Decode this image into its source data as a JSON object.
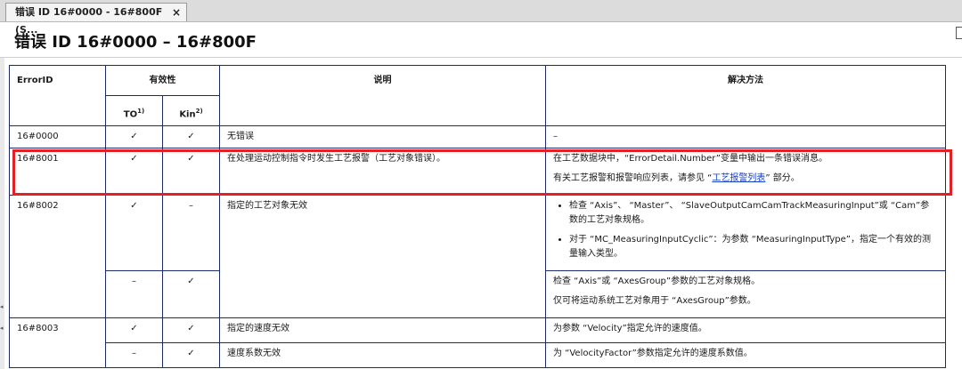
{
  "tab": {
    "label": "错误 ID 16#0000 - 16#800F (S...",
    "close_glyph": "×"
  },
  "page": {
    "title": "错误 ID 16#0000 – 16#800F"
  },
  "table": {
    "headers": {
      "error_id": "ErrorID",
      "validity": "有效性",
      "description": "说明",
      "remedy": "解决方法",
      "to": "TO",
      "to_note": "1)",
      "kin": "Kin",
      "kin_note": "2)"
    },
    "rows": [
      {
        "id": "16#0000",
        "to": "✓",
        "kin": "✓",
        "description": "无错误",
        "remedy": "–"
      },
      {
        "id": "16#8001",
        "to": "✓",
        "kin": "✓",
        "description": "在处理运动控制指令时发生工艺报警（工艺对象错误）。",
        "remedy_line1": "在工艺数据块中，“ErrorDetail.Number”变量中输出一条错误消息。",
        "remedy_line2_prefix": "有关工艺报警和报警响应列表，请参见 “",
        "remedy_link": "工艺报警列表",
        "remedy_line2_suffix": "” 部分。"
      },
      {
        "id": "16#8002",
        "description": "指定的工艺对象无效",
        "sub": [
          {
            "to": "✓",
            "kin": "–",
            "remedy_bullets": [
              "检查 “Axis”、 “Master”、 “SlaveOutputCamCamTrackMeasuringInput”或 “Cam”参数的工艺对象规格。",
              "对于 “MC_MeasuringInputCyclic”：为参数 “MeasuringInputType”，指定一个有效的测量输入类型。"
            ]
          },
          {
            "to": "–",
            "kin": "✓",
            "remedy_line1": "检查 “Axis”或 “AxesGroup”参数的工艺对象规格。",
            "remedy_line2": "仅可将运动系统工艺对象用于 “AxesGroup”参数。"
          }
        ]
      },
      {
        "id": "16#8003",
        "sub": [
          {
            "to": "✓",
            "kin": "✓",
            "description": "指定的速度无效",
            "remedy": "为参数 “Velocity”指定允许的速度值。"
          },
          {
            "to": "–",
            "kin": "✓",
            "description": "速度系数无效",
            "remedy": "为 “VelocityFactor”参数指定允许的速度系数值。"
          }
        ]
      }
    ]
  },
  "colors": {
    "table_border": "#1f2a6b",
    "highlight": "#e32125",
    "link": "#1540c8"
  }
}
